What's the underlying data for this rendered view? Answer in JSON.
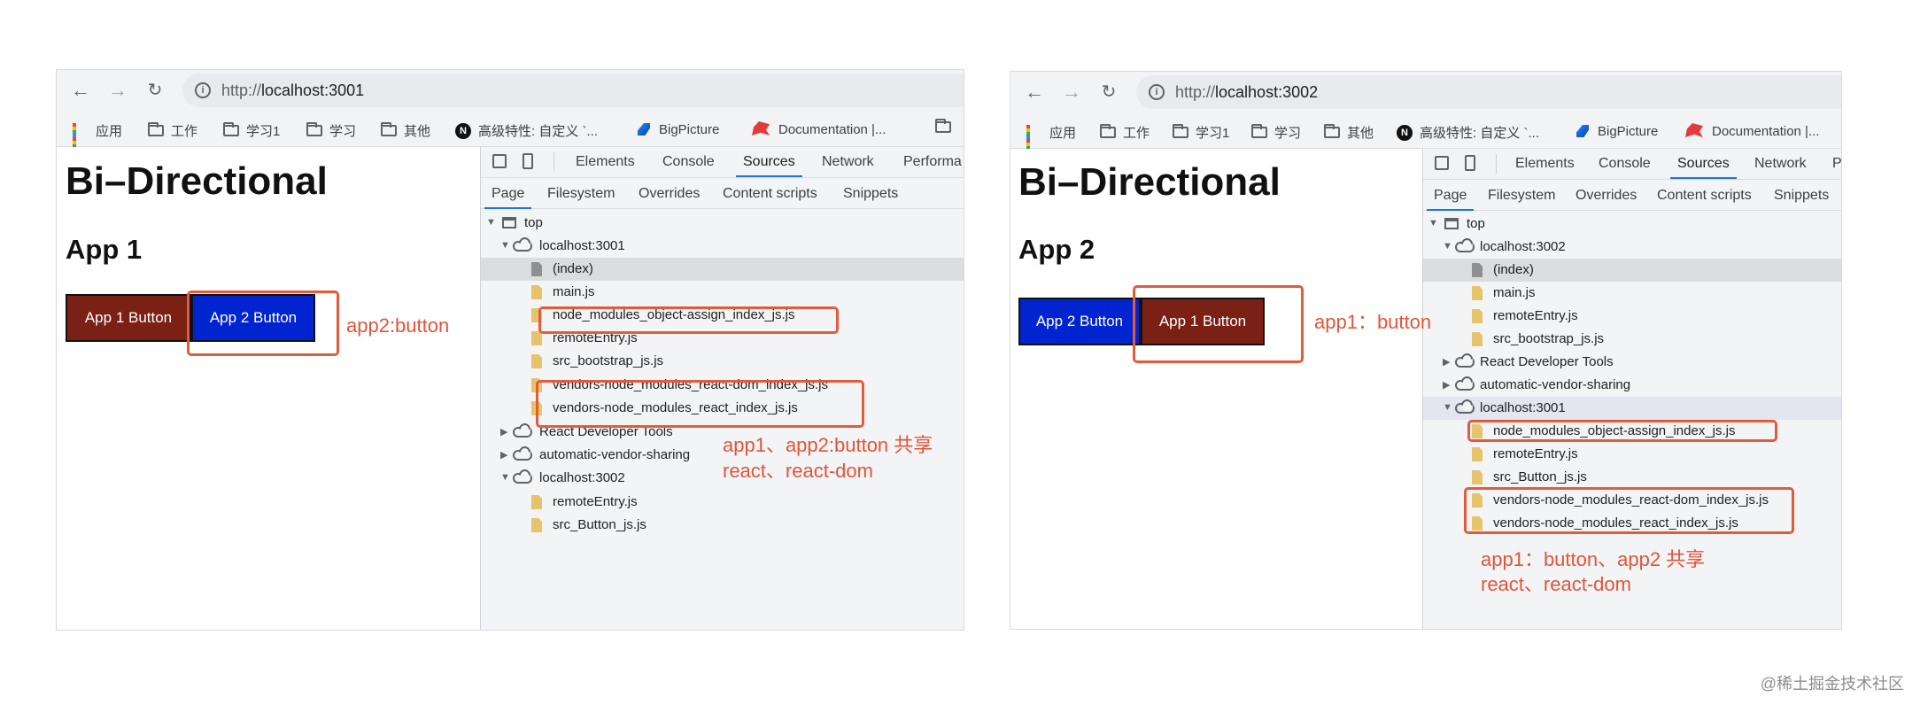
{
  "colors": {
    "annotation": "#e25c3b",
    "app1_button_bg": "#7a2015",
    "app2_button_bg": "#0024cf",
    "devtools_accent": "#1a73e8"
  },
  "windows": [
    {
      "url_prefix": "http://",
      "url_host": "localhost:3001",
      "bookmarks": [
        "应用",
        "工作",
        "学习1",
        "学习",
        "其他",
        "高级特性: 自定义 `...",
        "BigPicture",
        "Documentation |..."
      ],
      "page": {
        "title": "Bi–Directional",
        "subtitle": "App 1",
        "buttons": [
          "App 1 Button",
          "App 2 Button"
        ]
      },
      "devtools": {
        "tabs": [
          "Elements",
          "Console",
          "Sources",
          "Network",
          "Performa"
        ],
        "active_tab": "Sources",
        "subtabs": [
          "Page",
          "Filesystem",
          "Overrides",
          "Content scripts",
          "Snippets"
        ],
        "active_subtab": "Page",
        "tree": [
          "top",
          "localhost:3001",
          "(index)",
          "main.js",
          "node_modules_object-assign_index_js.js",
          "remoteEntry.js",
          "src_bootstrap_js.js",
          "vendors-node_modules_react-dom_index_js.js",
          "vendors-node_modules_react_index_js.js",
          "React Developer Tools",
          "automatic-vendor-sharing",
          "localhost:3002",
          "remoteEntry.js",
          "src_Button_js.js"
        ]
      },
      "annotations": {
        "button_note": "app2:button",
        "shared_note_line1": "app1、app2:button 共享",
        "shared_note_line2": "react、react-dom"
      }
    },
    {
      "url_prefix": "http://",
      "url_host": "localhost:3002",
      "bookmarks": [
        "应用",
        "工作",
        "学习1",
        "学习",
        "其他",
        "高级特性: 自定义 `...",
        "BigPicture",
        "Documentation |..."
      ],
      "page": {
        "title": "Bi–Directional",
        "subtitle": "App 2",
        "buttons": [
          "App 2 Button",
          "App 1 Button"
        ]
      },
      "devtools": {
        "tabs": [
          "Elements",
          "Console",
          "Sources",
          "Network",
          "P"
        ],
        "active_tab": "Sources",
        "subtabs": [
          "Page",
          "Filesystem",
          "Overrides",
          "Content scripts",
          "Snippets"
        ],
        "active_subtab": "Page",
        "tree": [
          "top",
          "localhost:3002",
          "(index)",
          "main.js",
          "remoteEntry.js",
          "src_bootstrap_js.js",
          "React Developer Tools",
          "automatic-vendor-sharing",
          "localhost:3001",
          "node_modules_object-assign_index_js.js",
          "remoteEntry.js",
          "src_Button_js.js",
          "vendors-node_modules_react-dom_index_js.js",
          "vendors-node_modules_react_index_js.js"
        ]
      },
      "annotations": {
        "button_note": "app1：button",
        "shared_note_line1": "app1：button、app2 共享",
        "shared_note_line2": "react、react-dom"
      }
    }
  ],
  "watermark": "@稀土掘金技术社区"
}
